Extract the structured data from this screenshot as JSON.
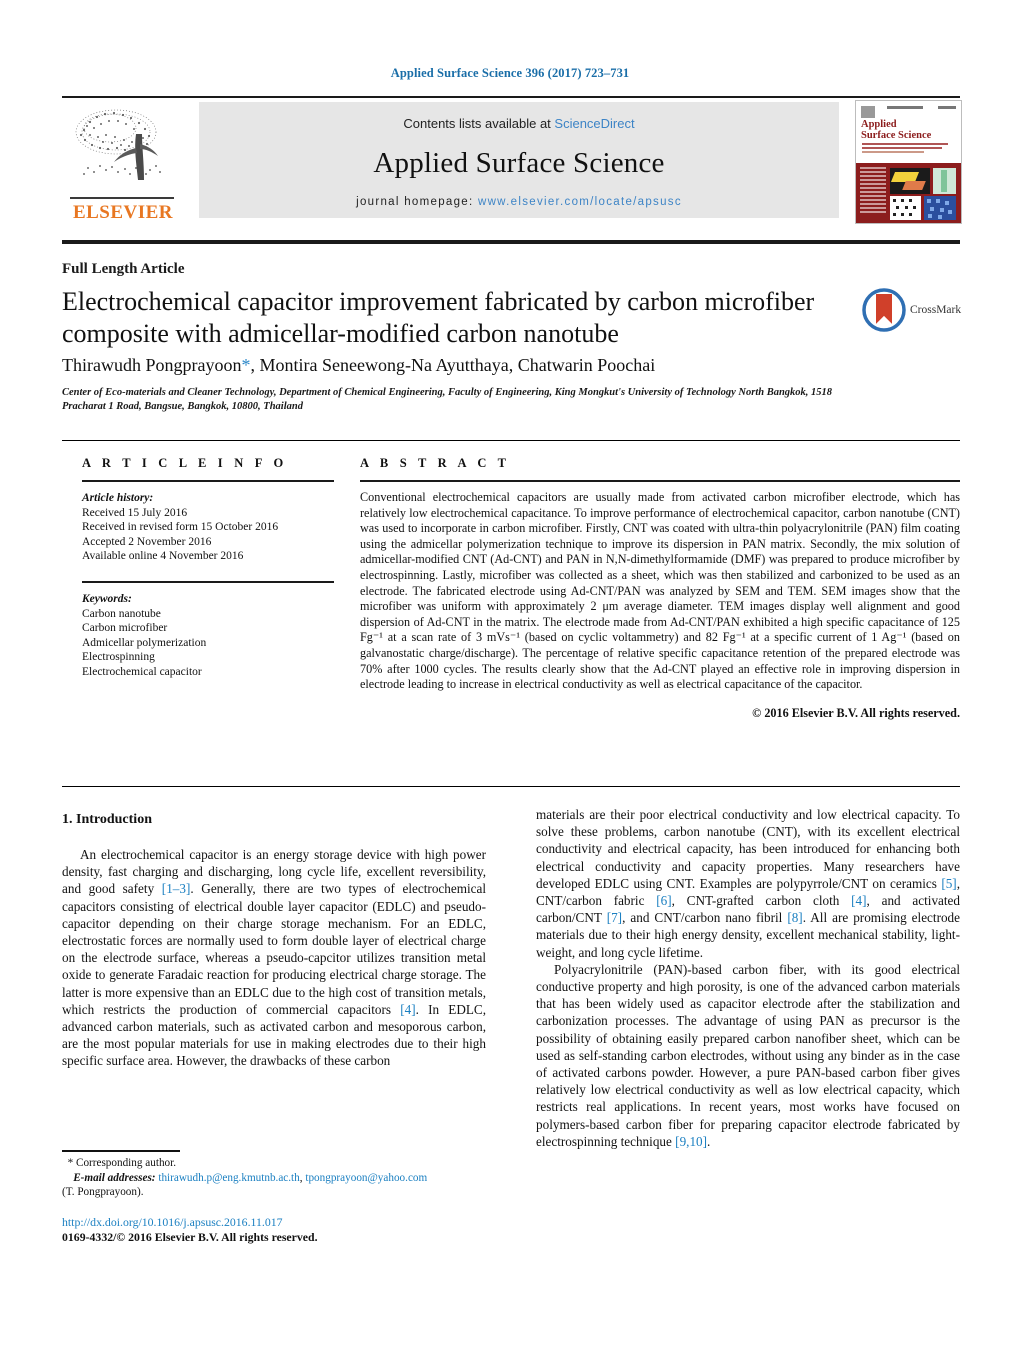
{
  "running_head": "Applied Surface Science 396 (2017) 723–731",
  "masthead": {
    "publisher_name": "ELSEVIER",
    "contents_prefix": "Contents lists available at ",
    "contents_link": "ScienceDirect",
    "journal_title": "Applied Surface Science",
    "homepage_prefix": "journal homepage: ",
    "homepage_link": "www.elsevier.com/locate/apsusc",
    "cover": {
      "title_line1": "Applied",
      "title_line2": "Surface Science"
    }
  },
  "article": {
    "type": "Full Length Article",
    "title": "Electrochemical capacitor improvement fabricated by carbon microfiber composite with admicellar-modified carbon nanotube",
    "crossmark_label": "CrossMark",
    "authors": "Thirawudh Pongprayoon",
    "authors_rest": ", Montira Seneewong-Na Ayutthaya, Chatwarin Poochai",
    "corresponding_marker": "*",
    "affiliation": "Center of Eco-materials and Cleaner Technology, Department of Chemical Engineering, Faculty of Engineering, King Mongkut's University of Technology North Bangkok, 1518 Pracharat 1 Road, Bangsue, Bangkok, 10800, Thailand"
  },
  "article_info": {
    "label": "A R T I C L E    I N F O",
    "history_label": "Article history:",
    "history": [
      "Received 15 July 2016",
      "Received in revised form 15 October 2016",
      "Accepted 2 November 2016",
      "Available online 4 November 2016"
    ],
    "keywords_label": "Keywords:",
    "keywords": [
      "Carbon nanotube",
      "Carbon microfiber",
      "Admicellar polymerization",
      "Electrospinning",
      "Electrochemical capacitor"
    ]
  },
  "abstract": {
    "label": "A B S T R A C T",
    "text": "Conventional electrochemical capacitors are usually made from activated carbon microfiber electrode, which has relatively low electrochemical capacitance. To improve performance of electrochemical capacitor, carbon nanotube (CNT) was used to incorporate in carbon microfiber. Firstly, CNT was coated with ultra-thin polyacrylonitrile (PAN) film coating using the admicellar polymerization technique to improve its dispersion in PAN matrix. Secondly, the mix solution of admicellar-modified CNT (Ad-CNT) and PAN in N,N-dimethylformamide (DMF) was prepared to produce microfiber by electrospinning. Lastly, microfiber was collected as a sheet, which was then stabilized and carbonized to be used as an electrode. The fabricated electrode using Ad-CNT/PAN was analyzed by SEM and TEM. SEM images show that the microfiber was uniform with approximately 2 μm average diameter. TEM images display well alignment and good dispersion of Ad-CNT in the matrix. The electrode made from Ad-CNT/PAN exhibited a high specific capacitance of 125 Fg⁻¹ at a scan rate of 3 mVs⁻¹ (based on cyclic voltammetry) and 82 Fg⁻¹ at a specific current of 1 Ag⁻¹ (based on galvanostatic charge/discharge). The percentage of relative specific capacitance retention of the prepared electrode was 70% after 1000 cycles. The results clearly show that the Ad-CNT played an effective role in improving dispersion in electrode leading to increase in electrical conductivity as well as electrical capacitance of the capacitor.",
    "copyright": "© 2016 Elsevier B.V. All rights reserved."
  },
  "body": {
    "section_heading": "1.  Introduction",
    "left_paragraph_1_a": "An electrochemical capacitor is an energy storage device with high power density, fast charging and discharging, long cycle life, excellent reversibility, and good safety ",
    "left_ref_1": "[1–3]",
    "left_paragraph_1_b": ". Generally, there are two types of electrochemical capacitors consisting of electrical double layer capacitor (EDLC) and pseudo-capacitor depending on their charge storage mechanism. For an EDLC, electrostatic forces are normally used to form double layer of electrical charge on the electrode surface, whereas a pseudo-capcitor utilizes transition metal oxide to generate Faradaic reaction for producing electrical charge storage. The latter is more expensive than an EDLC due to the high cost of transition metals, which restricts the production of commercial capacitors ",
    "left_ref_2": "[4]",
    "left_paragraph_1_c": ". In EDLC, advanced carbon materials, such as activated carbon and mesoporous carbon, are the most popular materials for use in making electrodes due to their high specific surface area. However, the drawbacks of these carbon",
    "right_paragraph_1_a": "materials are their poor electrical conductivity and low electrical capacity. To solve these problems, carbon nanotube (CNT), with its excellent electrical conductivity and electrical capacity, has been introduced for enhancing both electrical conductivity and capacity properties. Many researchers have developed EDLC using CNT. Examples are polypyrrole/CNT on ceramics ",
    "right_ref_1": "[5]",
    "right_paragraph_1_b": ", CNT/carbon fabric ",
    "right_ref_2": "[6]",
    "right_paragraph_1_c": ", CNT-grafted carbon cloth ",
    "right_ref_3": "[4]",
    "right_paragraph_1_d": ", and activated carbon/CNT ",
    "right_ref_4": "[7]",
    "right_paragraph_1_e": ", and CNT/carbon nano fibril ",
    "right_ref_5": "[8]",
    "right_paragraph_1_f": ". All are promising electrode materials due to their high energy density, excellent mechanical stability, light-weight, and long cycle lifetime.",
    "right_paragraph_2_a": "Polyacrylonitrile (PAN)-based carbon fiber, with its good electrical conductive property and high porosity, is one of the advanced carbon materials that has been widely used as capacitor electrode after the stabilization and carbonization processes. The advantage of using PAN as precursor is the possibility of obtaining easily prepared carbon nanofiber sheet, which can be used as self-standing carbon electrodes, without using any binder as in the case of activated carbons powder. However, a pure PAN-based carbon fiber gives relatively low electrical conductivity as well as low electrical capacity, which restricts real applications. In recent years, most works have focused on polymers-based carbon fiber for preparing capacitor electrode fabricated by electrospinning technique ",
    "right_ref_6": "[9,10]",
    "right_paragraph_2_b": "."
  },
  "footer": {
    "corresponding_marker": "*",
    "corresponding_label": " Corresponding author.",
    "email_label": "E-mail addresses:",
    "email_1": "thirawudh.p@eng.kmutnb.ac.th",
    "email_2": "tpongprayoon@yahoo.com",
    "email_attrib": "(T. Pongprayoon).",
    "doi": "http://dx.doi.org/10.1016/j.apsusc.2016.11.017",
    "issn_line": "0169-4332/© 2016 Elsevier B.V. All rights reserved."
  },
  "colors": {
    "link_blue": "#1a7fc1",
    "header_blue": "#1a6ea8",
    "elsevier_orange": "#e87722",
    "cover_red": "#8c1d1d",
    "sciencedirect_blue": "#3d84c6"
  }
}
